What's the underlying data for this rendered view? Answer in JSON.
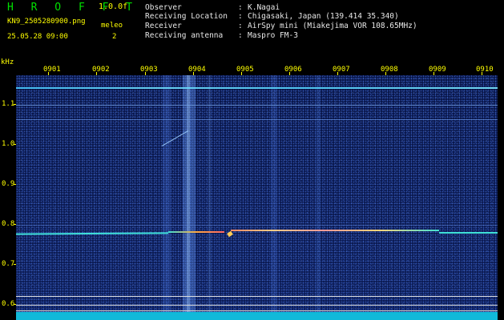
{
  "header": {
    "app_title": "H R O F F T",
    "version": "1.0.0f",
    "filename": "KN9_2505280900.png",
    "mode": "meleo",
    "datetime": "25.05.28 09:00",
    "count": "2"
  },
  "metadata": {
    "observer_label": "Observer",
    "observer_value": "K.Nagai",
    "location_label": "Receiving Location",
    "location_value": "Chigasaki, Japan (139.414 35.340)",
    "receiver_label": "Receiver",
    "receiver_value": "AirSpy mini (Miakejima VOR 108.65MHz)",
    "antenna_label": "Receiving antenna",
    "antenna_value": "Maspro FM-3",
    "separator": ":"
  },
  "axis": {
    "y_unit": "kHz",
    "y_ticks": [
      "1.1",
      "1.0",
      "0.9",
      "0.8",
      "0.7",
      "0.6"
    ],
    "x_ticks": [
      "0901",
      "0902",
      "0903",
      "0904",
      "0905",
      "0906",
      "0907",
      "0908",
      "0909",
      "0910"
    ]
  },
  "colors": {
    "label_yellow": "#ffff00",
    "title_green": "#00e000",
    "background_blue": "#06113d",
    "trace_cyan": "#2fe6ff",
    "noise_floor": "#11b9d9"
  }
}
